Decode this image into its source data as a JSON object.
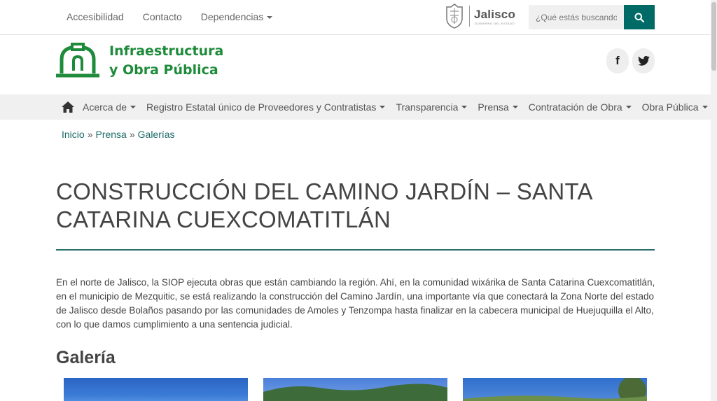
{
  "topbar": {
    "links": [
      "Accesibilidad",
      "Contacto",
      "Dependencias"
    ],
    "jalisco_name": "Jalisco",
    "jalisco_sub": "GOBIERNO DEL ESTADO",
    "search_placeholder": "¿Qué estás buscando?",
    "search_icon": "search-icon"
  },
  "brand": {
    "line1": "Infraestructura",
    "line2": "y Obra Pública",
    "color": "#1e8b3b"
  },
  "social": {
    "facebook": "f",
    "twitter_icon": "twitter-icon"
  },
  "nav": {
    "home_icon": "home-icon",
    "items": [
      "Acerca de",
      "Registro Estatal único de Proveedores y Contratistas",
      "Transparencia",
      "Prensa",
      "Contratación de Obra",
      "Obra Pública"
    ]
  },
  "breadcrumb": {
    "items": [
      "Inicio",
      "Prensa",
      "Galerías"
    ],
    "separator": "»"
  },
  "page": {
    "title": "CONSTRUCCIÓN DEL CAMINO JARDÍN – SANTA CATARINA CUEXCOMATITLÁN",
    "body": "En el norte de Jalisco, la SIOP ejecuta obras que están cambiando la región. Ahí, en la comunidad wixárika de Santa Catarina Cuexcomatitlán, en el municipio de Mezquitic, se está realizando la construcción del Camino Jardín, una importante vía que conectará la Zona Norte del estado de Jalisco desde Bolaños pasando por las comunidades de Amoles y Tenzompa hasta finalizar en la cabecera municipal de Huejuquilla el Alto, con lo que damos cumplimiento a una sentencia judicial.",
    "gallery_heading": "Galería",
    "accent": "#006b66"
  }
}
